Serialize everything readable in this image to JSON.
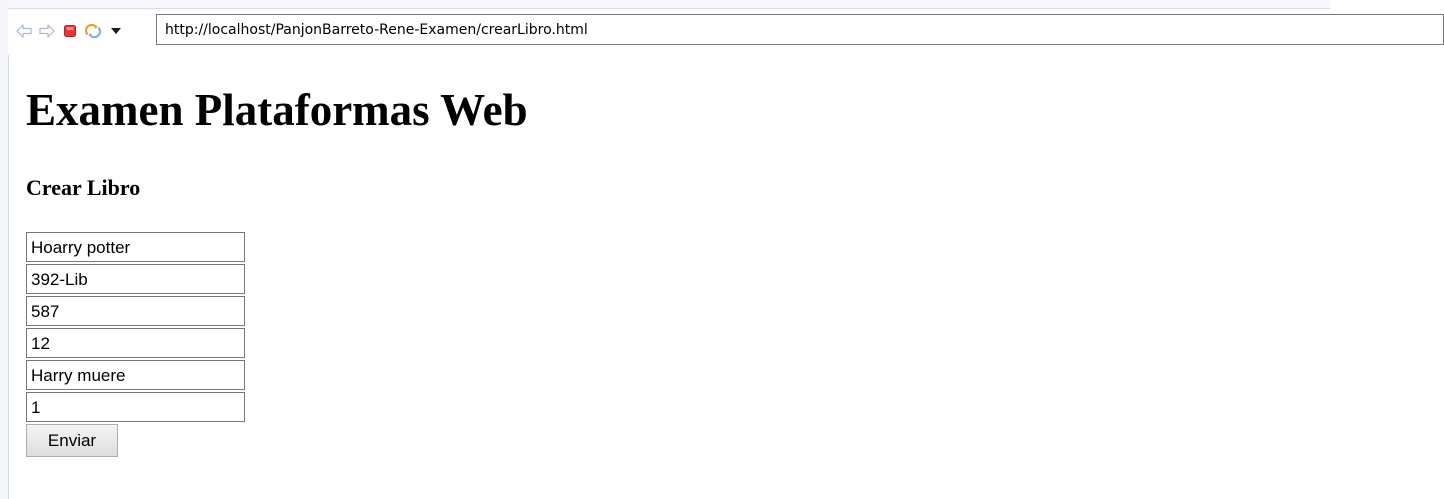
{
  "browser": {
    "url": "http://localhost/PanjonBarreto-Rene-Examen/crearLibro.html",
    "toolbar_icons": [
      "back-arrow-icon",
      "forward-arrow-icon",
      "stop-icon",
      "refresh-icon",
      "dropdown-arrow-icon"
    ],
    "colors": {
      "stop": "#e4383c",
      "refresh": "#e0a526",
      "arrow_disabled": "#b9c6d6"
    }
  },
  "page": {
    "title": "Examen Plataformas Web",
    "subtitle": "Crear Libro"
  },
  "form": {
    "fields": [
      {
        "value": "Hoarry potter"
      },
      {
        "value": "392-Lib"
      },
      {
        "value": "587"
      },
      {
        "value": "12"
      },
      {
        "value": "Harry muere"
      },
      {
        "value": "1"
      }
    ],
    "submit_label": "Enviar"
  }
}
